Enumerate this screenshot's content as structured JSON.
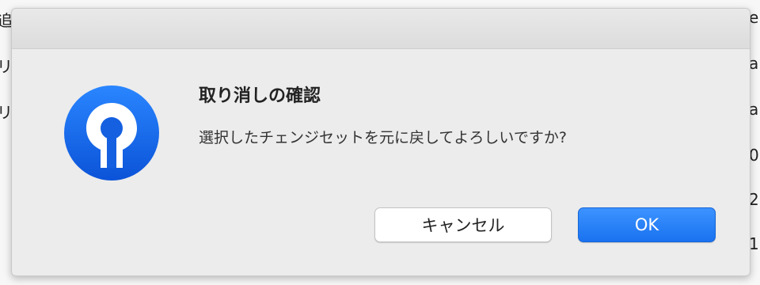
{
  "background": {
    "left_fragments": [
      "追",
      "リ",
      "リ"
    ],
    "right_fragments": [
      "e",
      "a",
      "a",
      "0",
      "2",
      "1"
    ]
  },
  "dialog": {
    "title": "取り消しの確認",
    "message": "選択したチェンジセットを元に戻してよろしいですか?",
    "app_icon": "sourcetree-logo-icon",
    "buttons": {
      "cancel_label": "キャンセル",
      "ok_label": "OK"
    }
  },
  "colors": {
    "accent": "#1a72f0",
    "icon_blue": "#1560e0",
    "dialog_bg": "#ececec"
  }
}
